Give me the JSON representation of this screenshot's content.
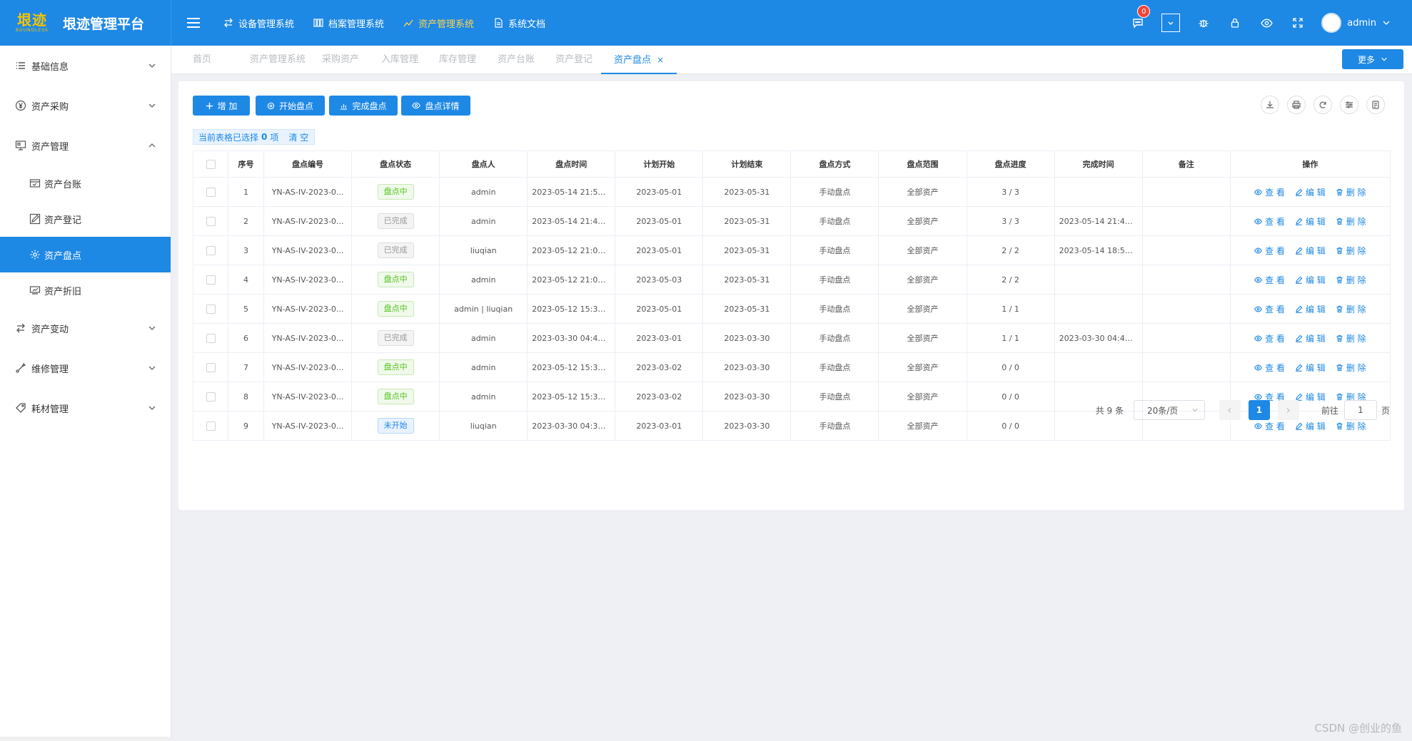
{
  "header": {
    "logo_main": "垠迹",
    "logo_sub": "BOUNDLESS",
    "title": "垠迹管理平台",
    "nav": [
      {
        "label": "设备管理系统",
        "icon": "swap-icon",
        "active": false
      },
      {
        "label": "档案管理系统",
        "icon": "archive-icon",
        "active": false
      },
      {
        "label": "资产管理系统",
        "icon": "chart-icon",
        "active": true
      },
      {
        "label": "系统文档",
        "icon": "document-icon",
        "active": false
      }
    ],
    "notification_count": "0",
    "username": "admin"
  },
  "sidebar": {
    "items": [
      {
        "label": "基础信息",
        "icon": "list-icon",
        "expanded": false
      },
      {
        "label": "资产采购",
        "icon": "yen-icon",
        "expanded": false
      },
      {
        "label": "资产管理",
        "icon": "monitor-icon",
        "expanded": true
      },
      {
        "label": "资产台账",
        "icon": "ledger-icon",
        "sub": true
      },
      {
        "label": "资产登记",
        "icon": "edit-icon",
        "sub": true
      },
      {
        "label": "资产盘点",
        "icon": "gear-icon",
        "sub": true,
        "active": true
      },
      {
        "label": "资产折旧",
        "icon": "depreciation-icon",
        "sub": true
      },
      {
        "label": "资产变动",
        "icon": "swap-icon",
        "expanded": false
      },
      {
        "label": "维修管理",
        "icon": "wrench-icon",
        "expanded": false
      },
      {
        "label": "耗材管理",
        "icon": "tag-icon",
        "expanded": false
      }
    ]
  },
  "tabs": [
    {
      "label": "首页"
    },
    {
      "label": "资产管理系统"
    },
    {
      "label": "采购资产"
    },
    {
      "label": "入库管理"
    },
    {
      "label": "库存管理"
    },
    {
      "label": "资产台账"
    },
    {
      "label": "资产登记"
    },
    {
      "label": "资产盘点",
      "active": true
    }
  ],
  "more_label": "更多",
  "toolbar": {
    "add": "增 加",
    "start": "开始盘点",
    "finish": "完成盘点",
    "detail": "盘点详情"
  },
  "selection": {
    "prefix": "当前表格已选择",
    "count": "0",
    "suffix": "项",
    "clear": "清 空"
  },
  "table": {
    "columns": [
      "序号",
      "盘点编号",
      "盘点状态",
      "盘点人",
      "盘点时间",
      "计划开始",
      "计划结束",
      "盘点方式",
      "盘点范围",
      "盘点进度",
      "完成时间",
      "备注",
      "操作"
    ],
    "rows": [
      {
        "no": "1",
        "code": "YN-AS-IV-2023-0...",
        "status": "盘点中",
        "status_type": "green",
        "person": "admin",
        "time": "2023-05-14 21:52:...",
        "start": "2023-05-01",
        "end": "2023-05-31",
        "method": "手动盘点",
        "range": "全部资产",
        "progress": "3 / 3",
        "done": "",
        "remark": ""
      },
      {
        "no": "2",
        "code": "YN-AS-IV-2023-0...",
        "status": "已完成",
        "status_type": "gray",
        "person": "admin",
        "time": "2023-05-14 21:43:...",
        "start": "2023-05-01",
        "end": "2023-05-31",
        "method": "手动盘点",
        "range": "全部资产",
        "progress": "3 / 3",
        "done": "2023-05-14 21:45:...",
        "remark": ""
      },
      {
        "no": "3",
        "code": "YN-AS-IV-2023-0...",
        "status": "已完成",
        "status_type": "gray",
        "person": "liuqian",
        "time": "2023-05-12 21:09:...",
        "start": "2023-05-01",
        "end": "2023-05-31",
        "method": "手动盘点",
        "range": "全部资产",
        "progress": "2 / 2",
        "done": "2023-05-14 18:58:...",
        "remark": ""
      },
      {
        "no": "4",
        "code": "YN-AS-IV-2023-0...",
        "status": "盘点中",
        "status_type": "green",
        "person": "admin",
        "time": "2023-05-12 21:07:...",
        "start": "2023-05-03",
        "end": "2023-05-31",
        "method": "手动盘点",
        "range": "全部资产",
        "progress": "2 / 2",
        "done": "",
        "remark": ""
      },
      {
        "no": "5",
        "code": "YN-AS-IV-2023-0...",
        "status": "盘点中",
        "status_type": "green",
        "person": "admin | liuqian",
        "time": "2023-05-12 15:38:...",
        "start": "2023-05-01",
        "end": "2023-05-31",
        "method": "手动盘点",
        "range": "全部资产",
        "progress": "1 / 1",
        "done": "",
        "remark": ""
      },
      {
        "no": "6",
        "code": "YN-AS-IV-2023-0...",
        "status": "已完成",
        "status_type": "gray",
        "person": "admin",
        "time": "2023-03-30 04:44:...",
        "start": "2023-03-01",
        "end": "2023-03-30",
        "method": "手动盘点",
        "range": "全部资产",
        "progress": "1 / 1",
        "done": "2023-03-30 04:46:...",
        "remark": ""
      },
      {
        "no": "7",
        "code": "YN-AS-IV-2023-0...",
        "status": "盘点中",
        "status_type": "green",
        "person": "admin",
        "time": "2023-05-12 15:38:...",
        "start": "2023-03-02",
        "end": "2023-03-30",
        "method": "手动盘点",
        "range": "全部资产",
        "progress": "0 / 0",
        "done": "",
        "remark": ""
      },
      {
        "no": "8",
        "code": "YN-AS-IV-2023-0...",
        "status": "盘点中",
        "status_type": "green",
        "person": "admin",
        "time": "2023-05-12 15:38:...",
        "start": "2023-03-02",
        "end": "2023-03-30",
        "method": "手动盘点",
        "range": "全部资产",
        "progress": "0 / 0",
        "done": "",
        "remark": ""
      },
      {
        "no": "9",
        "code": "YN-AS-IV-2023-0...",
        "status": "未开始",
        "status_type": "blue",
        "person": "liuqian",
        "time": "2023-03-30 04:34:...",
        "start": "2023-03-01",
        "end": "2023-03-30",
        "method": "手动盘点",
        "range": "全部资产",
        "progress": "0 / 0",
        "done": "",
        "remark": ""
      }
    ],
    "ops": {
      "view": "查 看",
      "edit": "编 辑",
      "delete": "删 除"
    }
  },
  "pager": {
    "total": "共 9 条",
    "size": "20条/页",
    "current": "1",
    "goto_prefix": "前往",
    "goto_value": "1",
    "goto_suffix": "页"
  },
  "watermark": "CSDN @创业的鱼",
  "colors": {
    "primary": "#1e88e5",
    "active_nav": "#ffd54f",
    "green_tag": "#52c41a",
    "badge": "#f44336"
  }
}
